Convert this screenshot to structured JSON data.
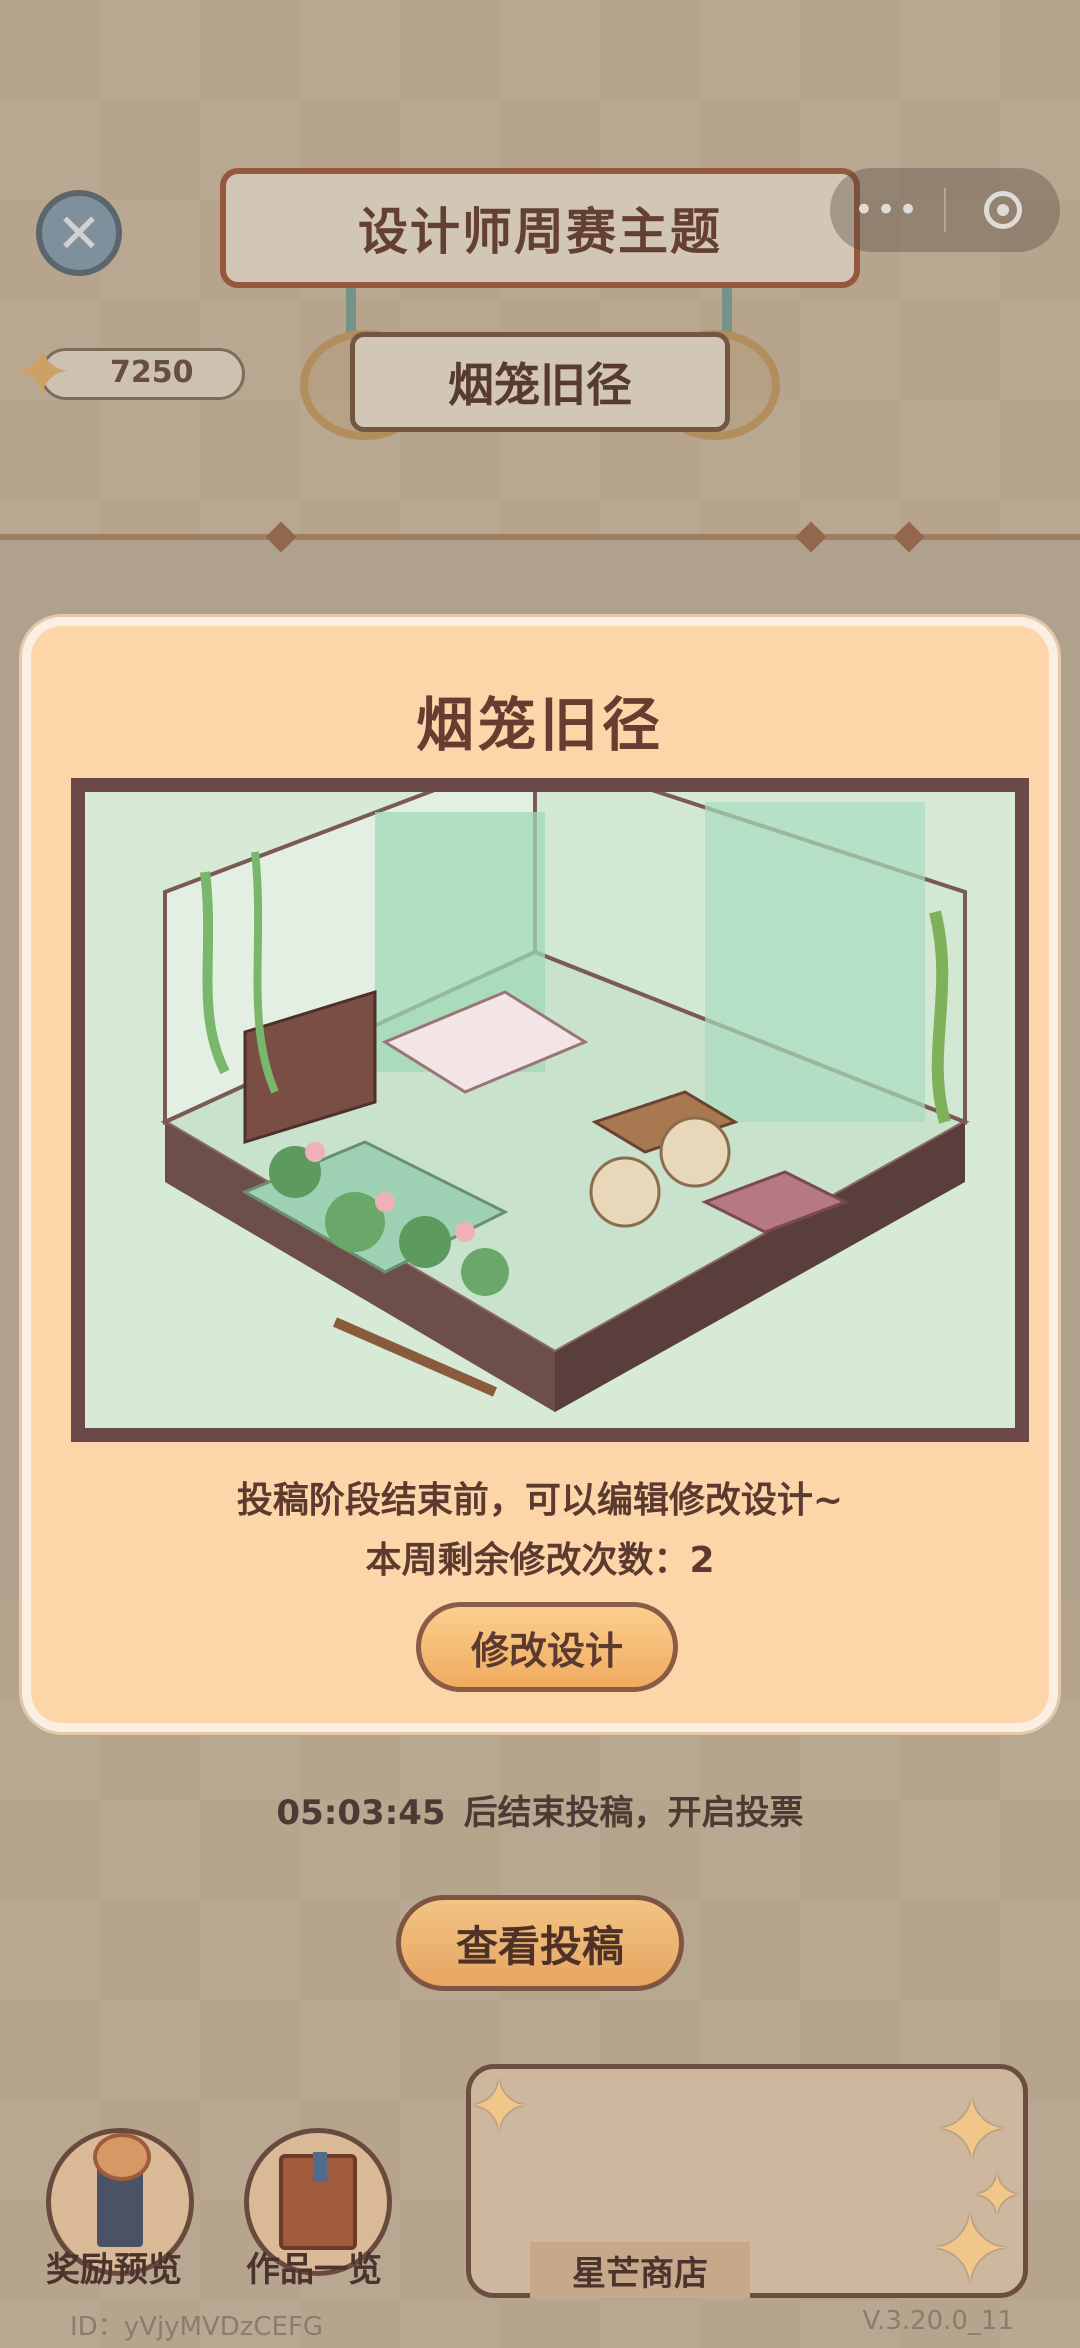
{
  "header": {
    "title": "设计师周赛主题",
    "theme_name": "烟笼旧径"
  },
  "currency": {
    "value": "7250",
    "icon": "star-icon"
  },
  "capsule": {
    "more_icon": "more-dots-icon",
    "close_icon": "target-icon"
  },
  "modal": {
    "title": "烟笼旧径",
    "note": "投稿阶段结束前，可以编辑修改设计~",
    "remaining_label": "本周剩余修改次数：",
    "remaining_count": "2",
    "edit_button": "修改设计"
  },
  "countdown": {
    "time": "05:03:45",
    "text": "后结束投稿，开启投票"
  },
  "view_button": "查看投稿",
  "bottom_nav": {
    "rewards": "奖励预览",
    "works": "作品一览",
    "shop": "星芒商店"
  },
  "footer": {
    "id": "ID：yVjyMVDzCEFG",
    "version": "V.3.20.0_11"
  },
  "colors": {
    "modal_bg": "#fcd6a8",
    "button_gold": "#f0ab5f",
    "text_brown": "#5d3a30"
  }
}
